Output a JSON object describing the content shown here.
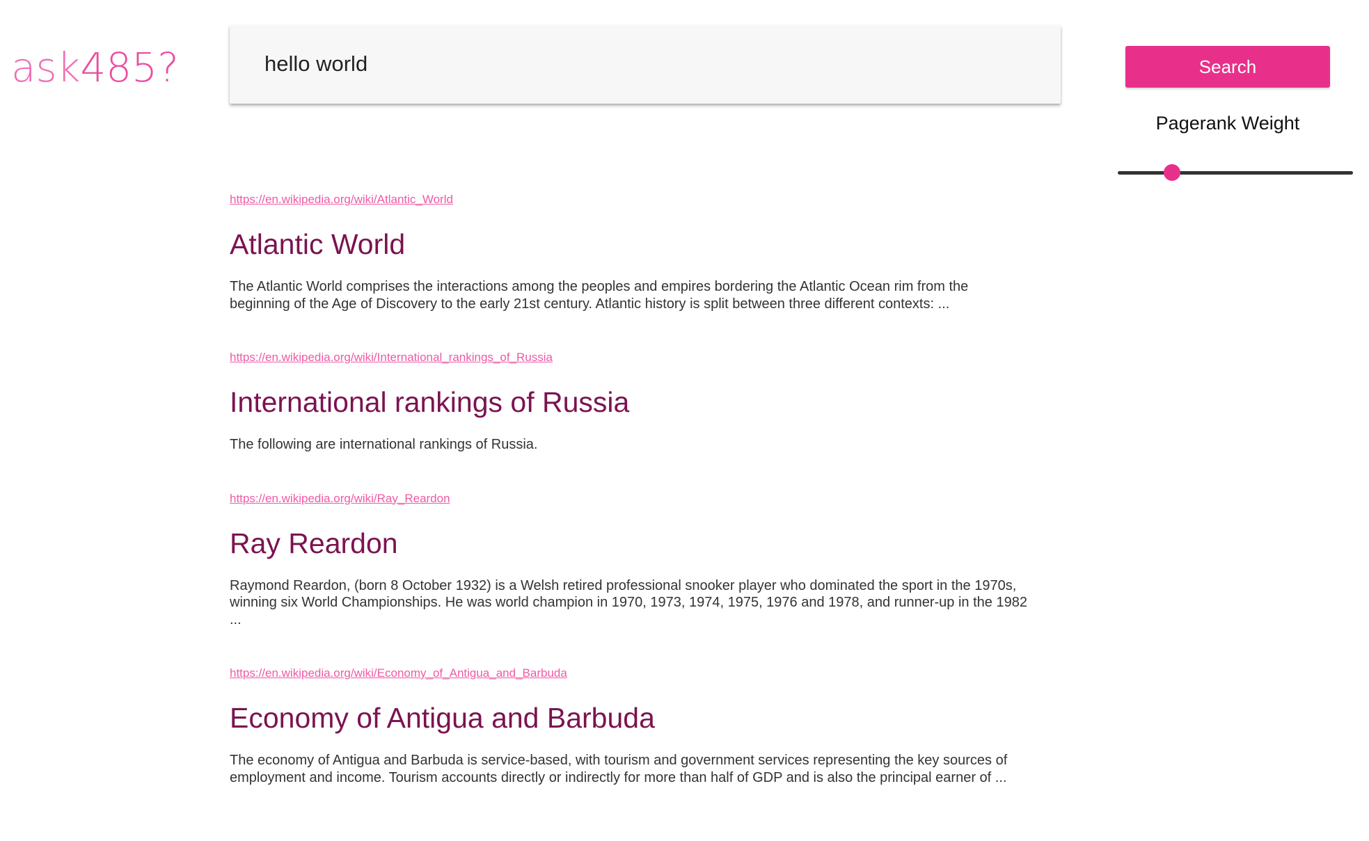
{
  "logo": {
    "prefix": "ask",
    "suffix": "485?"
  },
  "search": {
    "query": "hello world",
    "button_label": "Search"
  },
  "pagerank": {
    "label": "Pagerank Weight",
    "value_fraction": 0.23
  },
  "colors": {
    "accent": "#e8308b",
    "title": "#7b1350",
    "link": "#ee5aa6",
    "logo": "#ee6fb3"
  },
  "results": [
    {
      "url": "https://en.wikipedia.org/wiki/Atlantic_World",
      "title": "Atlantic World",
      "snippet": "The Atlantic World comprises the interactions among the peoples and empires bordering the Atlantic Ocean rim from the beginning of the Age of Discovery to the early 21st century. Atlantic history is split between three different contexts: ..."
    },
    {
      "url": "https://en.wikipedia.org/wiki/International_rankings_of_Russia",
      "title": "International rankings of Russia",
      "snippet": "The following are international rankings of Russia."
    },
    {
      "url": "https://en.wikipedia.org/wiki/Ray_Reardon",
      "title": "Ray Reardon",
      "snippet": "Raymond Reardon, (born 8 October 1932) is a Welsh retired professional snooker player who dominated the sport in the 1970s, winning six World Championships. He was world champion in 1970, 1973, 1974, 1975, 1976 and 1978, and runner-up in the 1982 ..."
    },
    {
      "url": "https://en.wikipedia.org/wiki/Economy_of_Antigua_and_Barbuda",
      "title": "Economy of Antigua and Barbuda",
      "snippet": "The economy of Antigua and Barbuda is service-based, with tourism and government services representing the key sources of employment and income. Tourism accounts directly or indirectly for more than half of GDP and is also the principal earner of ..."
    }
  ]
}
